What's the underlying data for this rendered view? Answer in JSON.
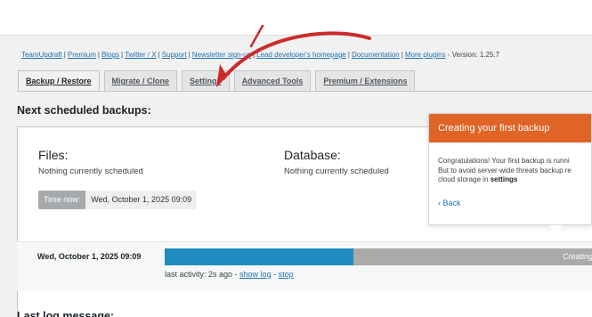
{
  "links": {
    "items": [
      "TeamUpdraft",
      "Premium",
      "Blogs",
      "Twitter / X",
      "Support",
      "Newsletter sign-up",
      "Lead developer's homepage",
      "Documentation",
      "More plugins"
    ],
    "version_text": " - Version: 1.25.7"
  },
  "tabs": [
    "Backup / Restore",
    "Migrate / Clone",
    "Settings",
    "Advanced Tools",
    "Premium / Extensions"
  ],
  "next_scheduled": {
    "title": "Next scheduled backups:",
    "files_label": "Files:",
    "files_status": "Nothing currently scheduled",
    "database_label": "Database:",
    "database_status": "Nothing currently scheduled",
    "time_now_label": "Time now:",
    "time_now_value": "Wed, October 1, 2025 09:09"
  },
  "running_job": {
    "date": "Wed, October 1, 2025 09:09",
    "progress_fraction": 0.43,
    "progress_text": "Creating fi",
    "activity_prefix": "last activity: 2s ago - ",
    "show_log": "show log",
    "separator": " - ",
    "stop": "stop"
  },
  "last_log": {
    "title": "Last log message:"
  },
  "tour_popup": {
    "title": "Creating your first backup",
    "line1": "Congratulations! Your first backup is runni",
    "line2": "But to avoid server-wide threats backup re",
    "line3_prefix": "cloud storage in ",
    "line3_bold": "settings",
    "back": "Back",
    "back_icon": "‹"
  },
  "colors": {
    "link": "#2271b1",
    "tour_header": "#df6426",
    "progress_fill": "#1e8cbe",
    "progress_track": "#aaaaaa",
    "annotation_arrow": "#cc2b2b"
  },
  "annotation": {
    "icon": "hand-drawn-arrow-icon"
  }
}
